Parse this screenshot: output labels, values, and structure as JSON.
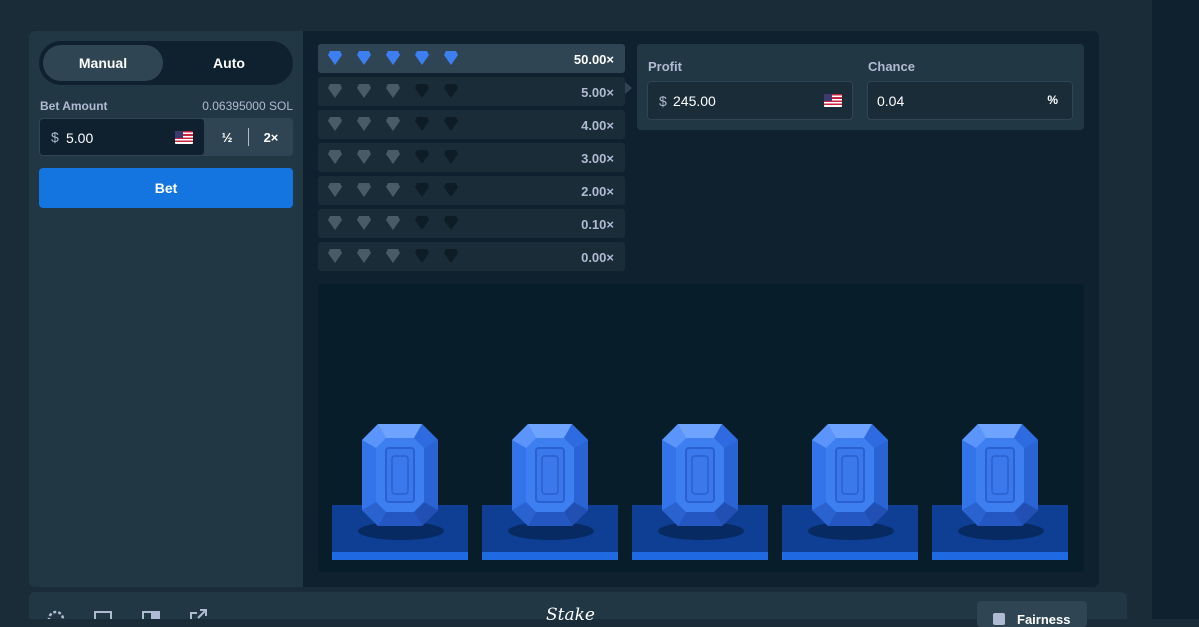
{
  "controls": {
    "tabs": [
      "Manual",
      "Auto"
    ],
    "bet_amount_label": "Bet Amount",
    "bet_amount_crypto": "0.06395000 SOL",
    "currency_symbol": "$",
    "bet_amount_value": "5.00",
    "half_label": "½",
    "double_label": "2×",
    "bet_button": "Bet"
  },
  "paytable": [
    {
      "gems_lit": 5,
      "multiplier": "50.00×",
      "active": true
    },
    {
      "gems_lit": 0,
      "multiplier": "5.00×"
    },
    {
      "gems_lit": 0,
      "multiplier": "4.00×"
    },
    {
      "gems_lit": 0,
      "multiplier": "3.00×"
    },
    {
      "gems_lit": 0,
      "multiplier": "2.00×"
    },
    {
      "gems_lit": 0,
      "multiplier": "0.10×"
    },
    {
      "gems_lit": 0,
      "multiplier": "0.00×"
    }
  ],
  "profit_panel": {
    "profit_label": "Profit",
    "profit_currency": "$",
    "profit_value": "245.00",
    "chance_label": "Chance",
    "chance_value": "0.04",
    "chance_unit": "%"
  },
  "stage": {
    "gems": [
      "blue-gem",
      "blue-gem",
      "blue-gem",
      "blue-gem",
      "blue-gem"
    ]
  },
  "footer": {
    "logo": "Stake",
    "fairness_label": "Fairness"
  },
  "colors": {
    "accent": "#1475e1",
    "gem_blue": "#3d7ff0",
    "panel": "#213743",
    "background": "#0f212e",
    "muted_text": "#b1bad3"
  }
}
